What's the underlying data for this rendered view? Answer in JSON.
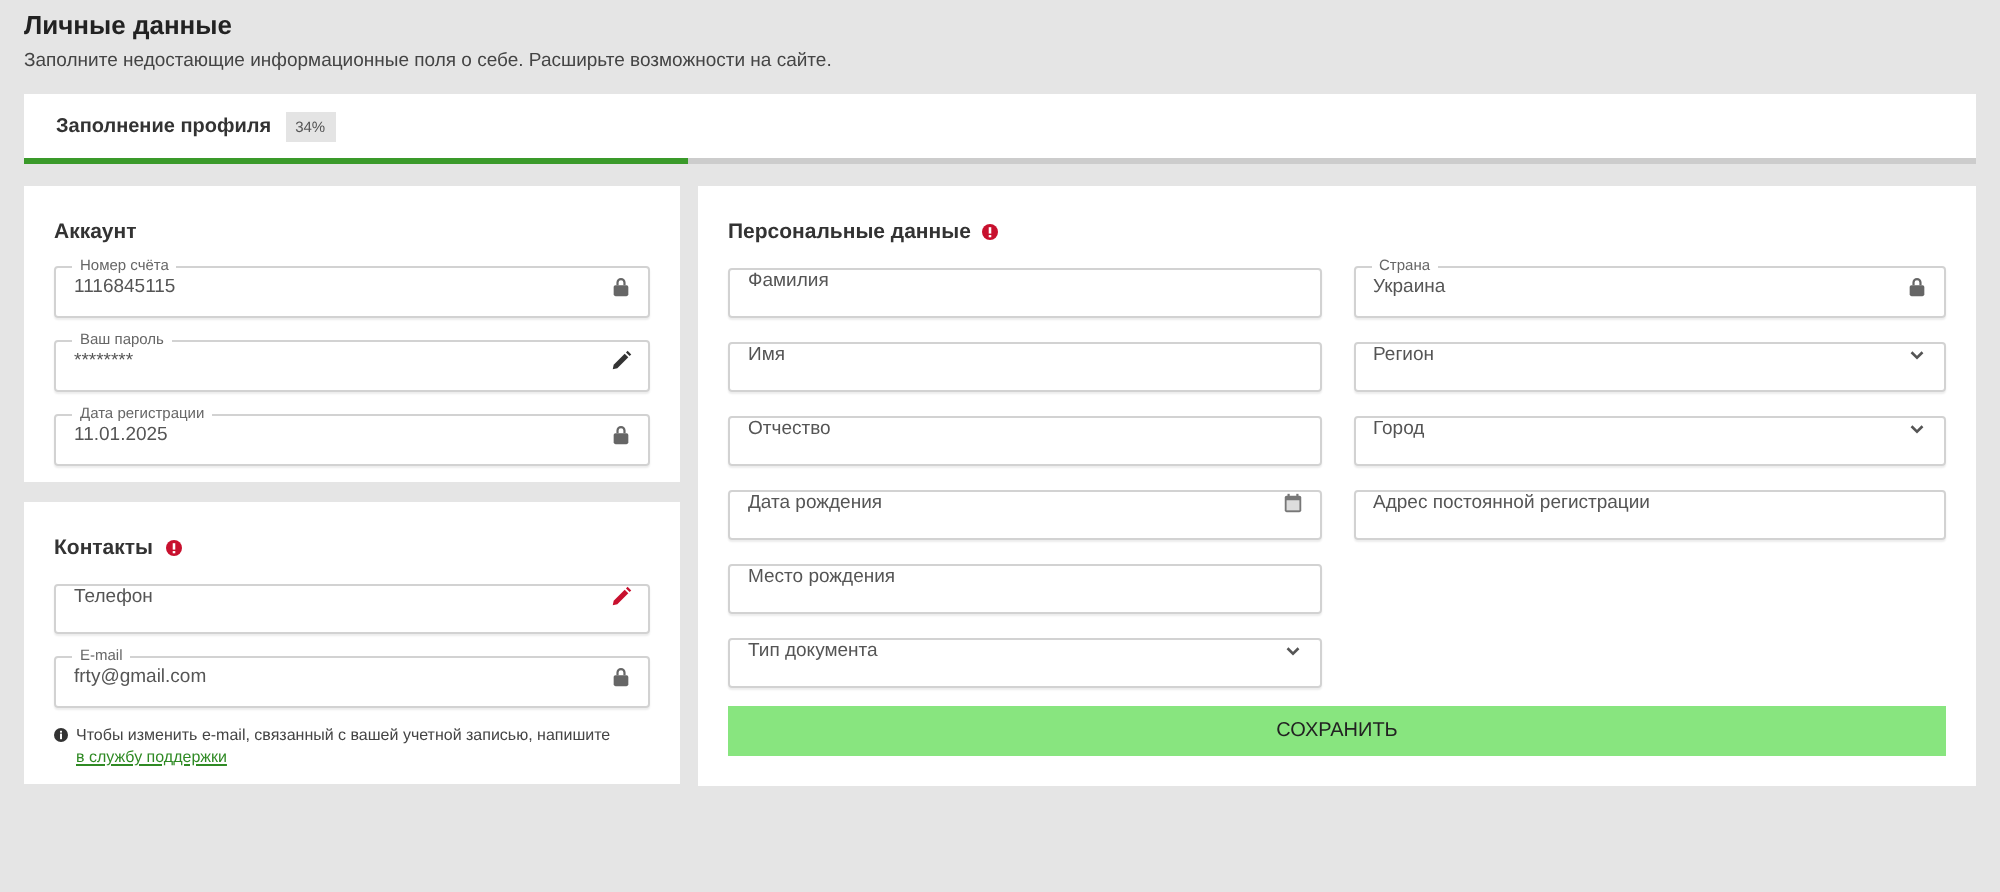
{
  "header": {
    "title": "Личные данные",
    "subtitle": "Заполните недостающие информационные поля о себе. Расширьте возможности на сайте."
  },
  "progress": {
    "label": "Заполнение профиля",
    "badge": "34%",
    "level": 0.34
  },
  "account": {
    "title": "Аккаунт",
    "fields": [
      {
        "label": "Номер счёта",
        "value": "1116845115",
        "kind": "locked"
      },
      {
        "label": "Ваш пароль",
        "value": "********",
        "kind": "editable"
      },
      {
        "label": "Дата регистрации",
        "value": "11.01.2025",
        "kind": "locked"
      }
    ]
  },
  "contacts": {
    "title": "Контакты",
    "required": true,
    "fields": [
      {
        "placeholder": "Телефон",
        "kind": "required"
      },
      {
        "label": "E-mail",
        "value": "frty@gmail.com",
        "kind": "locked"
      }
    ],
    "note": "Чтобы изменить e-mail, связанный с вашей учетной записью, напишите",
    "link": "в службу поддержки"
  },
  "personal": {
    "title": "Персональные данные",
    "required": true,
    "left_fields": [
      {
        "placeholder": "Фамилия",
        "kind": "text"
      },
      {
        "placeholder": "Имя",
        "kind": "text"
      },
      {
        "placeholder": "Отчество",
        "kind": "text"
      },
      {
        "placeholder": "Дата рождения",
        "kind": "date"
      },
      {
        "placeholder": "Место рождения",
        "kind": "text"
      },
      {
        "placeholder": "Тип документа",
        "kind": "select"
      }
    ],
    "right_fields": [
      {
        "label": "Страна",
        "value": "Украина",
        "kind": "locked"
      },
      {
        "placeholder": "Регион",
        "kind": "select"
      },
      {
        "placeholder": "Город",
        "kind": "select"
      },
      {
        "placeholder": "Адрес постоянной регистрации",
        "kind": "text"
      }
    ],
    "save_button": "СОХРАНИТЬ"
  }
}
